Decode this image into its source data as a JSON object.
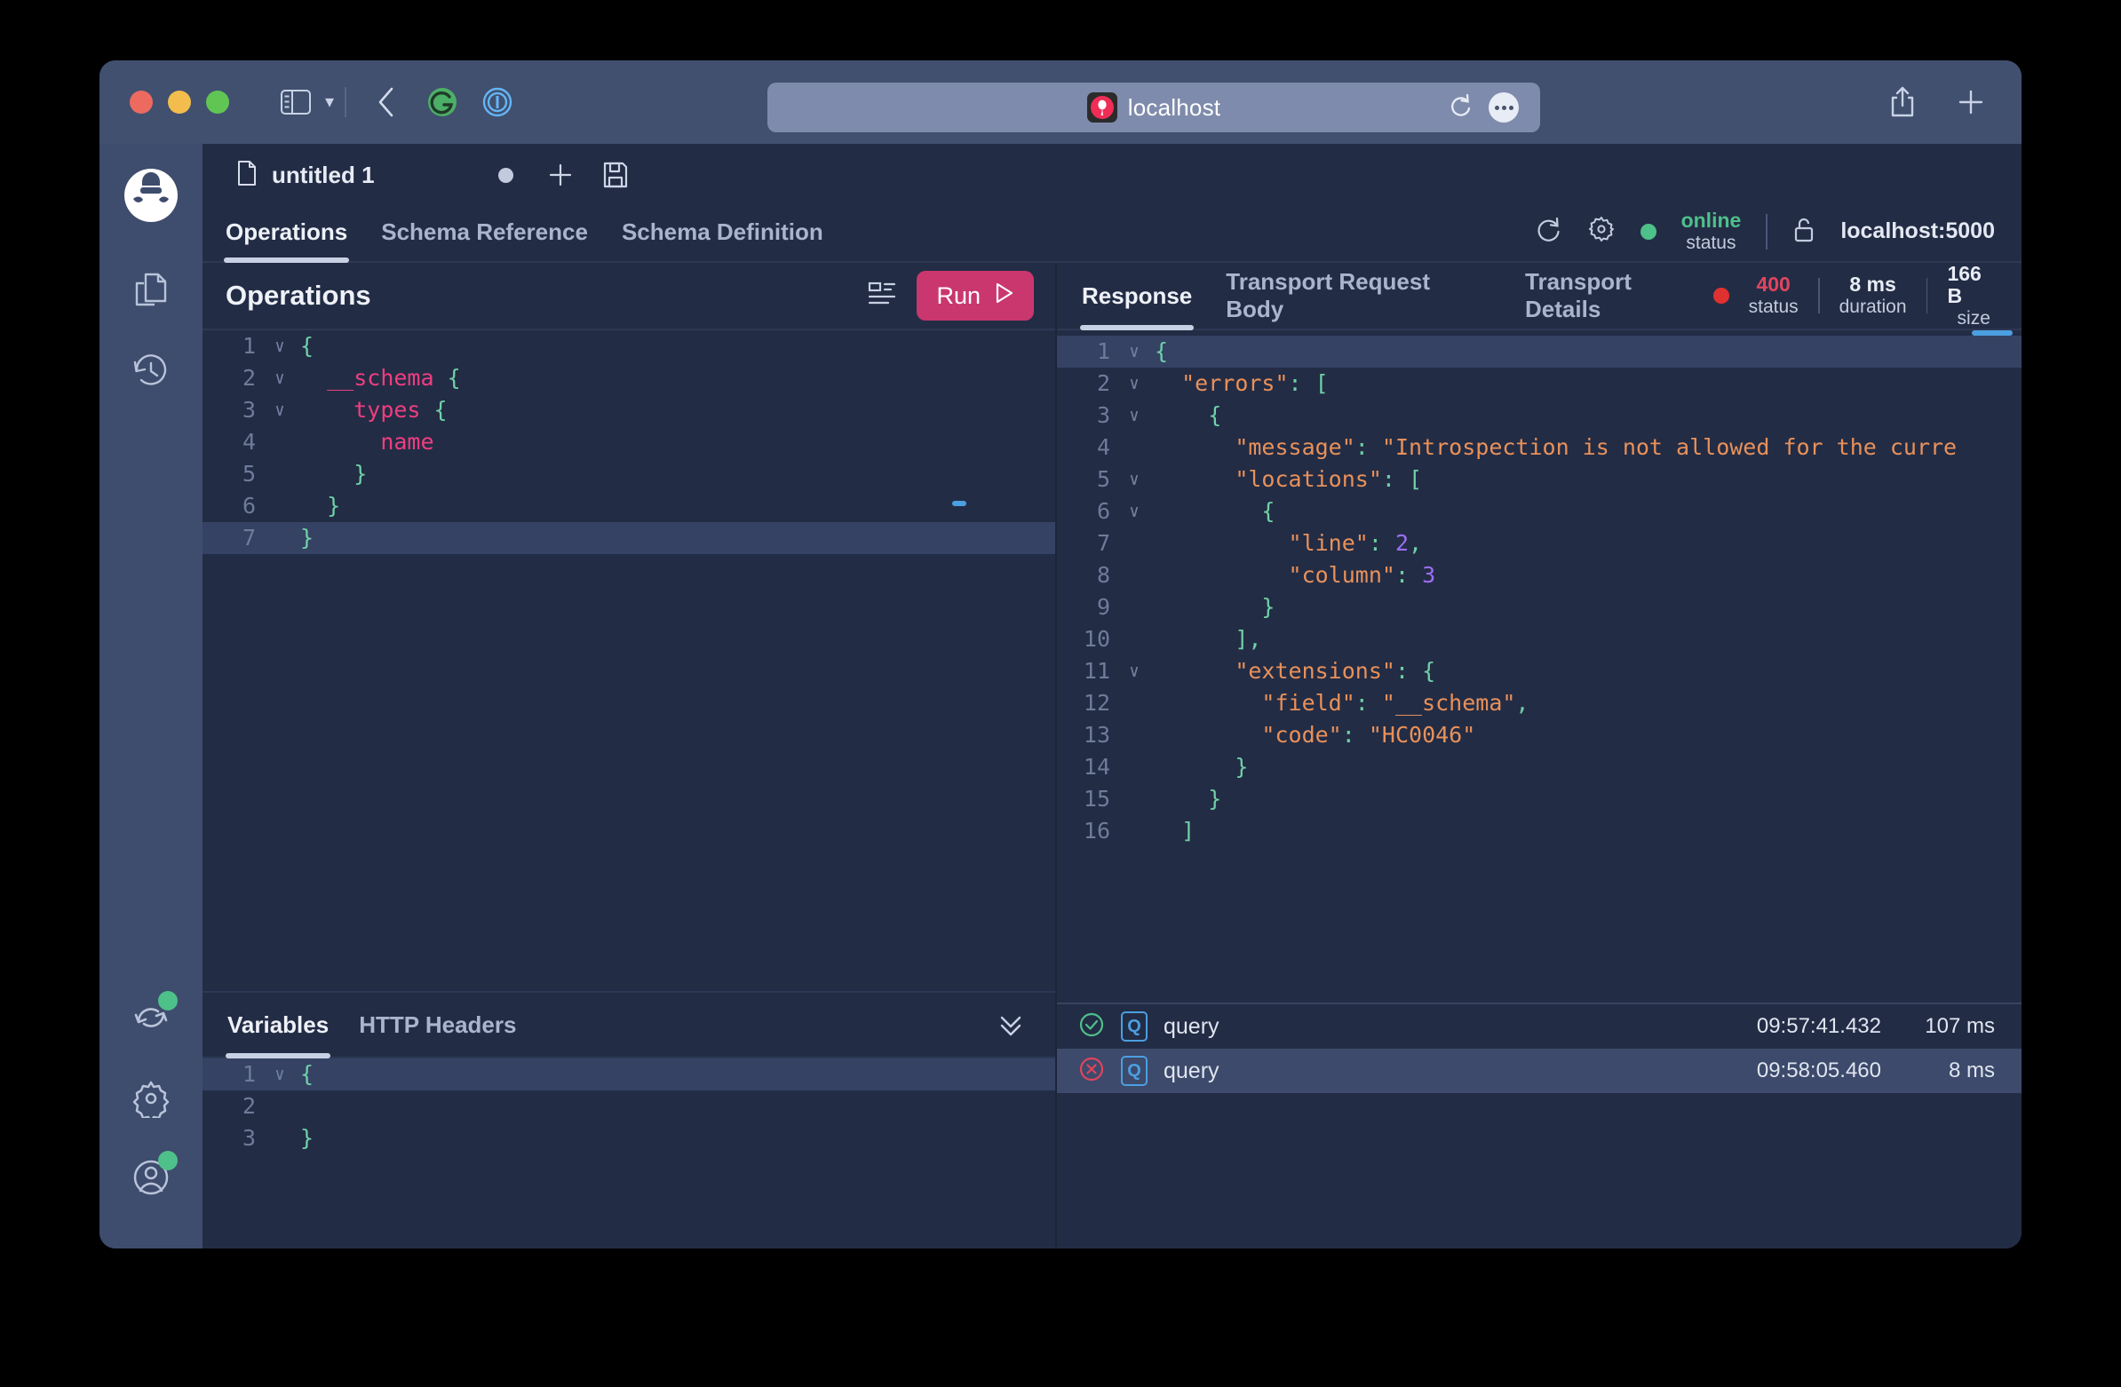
{
  "browser": {
    "url_text": "localhost",
    "icons": {
      "sidebar_toggle": "sidebar-toggle-icon",
      "tab_overview": "chevron-down-icon",
      "back": "back-chevron-icon",
      "grammarly": "grammarly-extension-icon",
      "onepassword": "1password-extension-icon",
      "reload": "reload-icon",
      "more": "more-dots-icon",
      "share": "share-icon",
      "new_tab": "plus-icon"
    }
  },
  "app": {
    "sidebar": [
      {
        "name": "logo",
        "icon": "banana-cake-pop-logo",
        "badge": false
      },
      {
        "name": "documents",
        "icon": "documents-icon",
        "badge": false
      },
      {
        "name": "history",
        "icon": "history-clock-icon",
        "badge": false
      },
      {
        "name": "sync",
        "icon": "sync-icon",
        "badge": true
      },
      {
        "name": "settings",
        "icon": "gear-icon",
        "badge": false
      },
      {
        "name": "account",
        "icon": "user-avatar-icon",
        "badge": true
      }
    ],
    "document_tab": {
      "label": "untitled 1",
      "icon": "document-icon",
      "dirty": true,
      "new_tab_icon": "plus-icon",
      "save_icon": "save-floppy-icon"
    },
    "nav_tabs": [
      {
        "label": "Operations",
        "active": true
      },
      {
        "label": "Schema Reference",
        "active": false
      },
      {
        "label": "Schema Definition",
        "active": false
      }
    ],
    "connection": {
      "refresh_icon": "refresh-icon",
      "settings_icon": "gear-icon",
      "status_value": "online",
      "status_label": "status",
      "status_color": "#4ec08a",
      "lock_icon": "unlock-icon",
      "endpoint": "localhost:5000"
    }
  },
  "operations": {
    "title": "Operations",
    "format_icon": "format-document-icon",
    "run_label": "Run",
    "run_icon": "play-icon",
    "run_color": "#c9376e",
    "editor_lines": [
      {
        "n": "1",
        "fold": "∨",
        "html": "<span class='brace'>{</span>"
      },
      {
        "n": "2",
        "fold": "∨",
        "html": "  <span class='kw'>__schema</span> <span class='brace'>{</span>"
      },
      {
        "n": "3",
        "fold": "∨",
        "html": "    <span class='kw'>types</span> <span class='brace'>{</span>"
      },
      {
        "n": "4",
        "fold": "",
        "html": "      <span class='kw'>name</span>"
      },
      {
        "n": "5",
        "fold": "",
        "html": "    <span class='brace'>}</span>"
      },
      {
        "n": "6",
        "fold": "",
        "html": "  <span class='brace'>}</span>"
      },
      {
        "n": "7",
        "fold": "",
        "html": "<span class='brace'>}</span>",
        "highlight": true
      }
    ]
  },
  "variables": {
    "tabs": [
      {
        "label": "Variables",
        "active": true
      },
      {
        "label": "HTTP Headers",
        "active": false
      }
    ],
    "collapse_icon": "double-chevron-down-icon",
    "editor_lines": [
      {
        "n": "1",
        "fold": "∨",
        "html": "<span class='brace'>{</span>",
        "highlight": true
      },
      {
        "n": "2",
        "fold": "",
        "html": ""
      },
      {
        "n": "3",
        "fold": "",
        "html": "<span class='brace'>}</span>"
      }
    ]
  },
  "response": {
    "tabs": [
      {
        "label": "Response",
        "active": true
      },
      {
        "label": "Transport Request Body",
        "active": false
      },
      {
        "label": "Transport Details",
        "active": false
      }
    ],
    "metrics": {
      "status_dot_color": "#e03131",
      "status_value": "400",
      "status_label": "status",
      "status_color": "#e0455e",
      "duration_value": "8 ms",
      "duration_label": "duration",
      "size_value": "166 B",
      "size_label": "size"
    },
    "editor_lines": [
      {
        "n": "1",
        "fold": "∨",
        "html": "<span class='brace'>{</span>",
        "highlight": true
      },
      {
        "n": "2",
        "fold": "∨",
        "html": "  <span class='key'>\"errors\"</span><span class='punc'>:</span> <span class='brace'>[</span>"
      },
      {
        "n": "3",
        "fold": "∨",
        "html": "    <span class='brace'>{</span>"
      },
      {
        "n": "4",
        "fold": "",
        "html": "      <span class='key'>\"message\"</span><span class='punc'>:</span> <span class='str'>\"Introspection is not allowed for the curre</span>"
      },
      {
        "n": "5",
        "fold": "∨",
        "html": "      <span class='key'>\"locations\"</span><span class='punc'>:</span> <span class='brace'>[</span>"
      },
      {
        "n": "6",
        "fold": "∨",
        "html": "        <span class='brace'>{</span>"
      },
      {
        "n": "7",
        "fold": "",
        "html": "          <span class='key'>\"line\"</span><span class='punc'>:</span> <span class='num'>2</span><span class='punc'>,</span>"
      },
      {
        "n": "8",
        "fold": "",
        "html": "          <span class='key'>\"column\"</span><span class='punc'>:</span> <span class='num'>3</span>"
      },
      {
        "n": "9",
        "fold": "",
        "html": "        <span class='brace'>}</span>"
      },
      {
        "n": "10",
        "fold": "",
        "html": "      <span class='brace'>]</span><span class='punc'>,</span>"
      },
      {
        "n": "11",
        "fold": "∨",
        "html": "      <span class='key'>\"extensions\"</span><span class='punc'>:</span> <span class='brace'>{</span>"
      },
      {
        "n": "12",
        "fold": "",
        "html": "        <span class='key'>\"field\"</span><span class='punc'>:</span> <span class='str'>\"__schema\"</span><span class='punc'>,</span>"
      },
      {
        "n": "13",
        "fold": "",
        "html": "        <span class='key'>\"code\"</span><span class='punc'>:</span> <span class='str'>\"HC0046\"</span>"
      },
      {
        "n": "14",
        "fold": "",
        "html": "      <span class='brace'>}</span>"
      },
      {
        "n": "15",
        "fold": "",
        "html": "    <span class='brace'>}</span>"
      },
      {
        "n": "16",
        "fold": "",
        "html": "  <span class='brace'>]</span>"
      }
    ],
    "history": [
      {
        "status": "success",
        "icon": "check-circle-icon",
        "type_badge": "Q",
        "name": "query",
        "time": "09:57:41.432",
        "duration": "107 ms",
        "selected": false
      },
      {
        "status": "error",
        "icon": "error-circle-icon",
        "type_badge": "Q",
        "name": "query",
        "time": "09:58:05.460",
        "duration": "8 ms",
        "selected": true
      }
    ]
  }
}
